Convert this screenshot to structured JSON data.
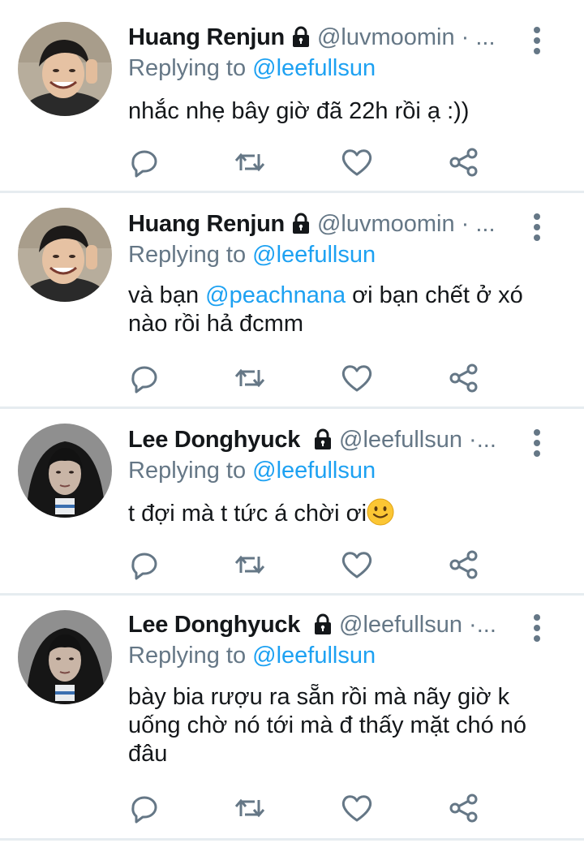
{
  "tweets": [
    {
      "name": "Huang Renjun",
      "handle": "@luvmoomin · ...",
      "replying_prefix": "Replying to",
      "replying_to": "@leefullsun",
      "text_parts": [
        "nhắc nhẹ bây giờ đã 22h rồi ạ :))"
      ]
    },
    {
      "name": "Huang Renjun",
      "handle": "@luvmoomin · ...",
      "replying_prefix": "Replying to",
      "replying_to": "@leefullsun",
      "text_before": "và bạn ",
      "text_mention": "@peachnana",
      "text_after": " ơi bạn chết ở xó nào rồi hả đcmm"
    },
    {
      "name": "Lee Donghyuck",
      "handle": "@leefullsun ·...",
      "replying_prefix": "Replying to",
      "replying_to": "@leefullsun",
      "text": "t đợi mà t tức á chời ơi",
      "emoji": "slightly-smiling-face"
    },
    {
      "name": "Lee Donghyuck",
      "handle": "@leefullsun ·...",
      "replying_prefix": "Replying to",
      "replying_to": "@leefullsun",
      "text": "bày bia rượu ra sẵn rồi mà nãy giờ k uống chờ nó tới mà đ thấy mặt chó nó đâu"
    }
  ],
  "icons": {
    "lock": "lock-icon",
    "more": "more-vertical-icon",
    "reply": "reply-icon",
    "retweet": "retweet-icon",
    "like": "heart-icon",
    "share": "share-icon"
  },
  "colors": {
    "mention": "#1da1f2",
    "secondary": "#657786",
    "text": "#14171a",
    "divider": "#e6ecf0"
  }
}
